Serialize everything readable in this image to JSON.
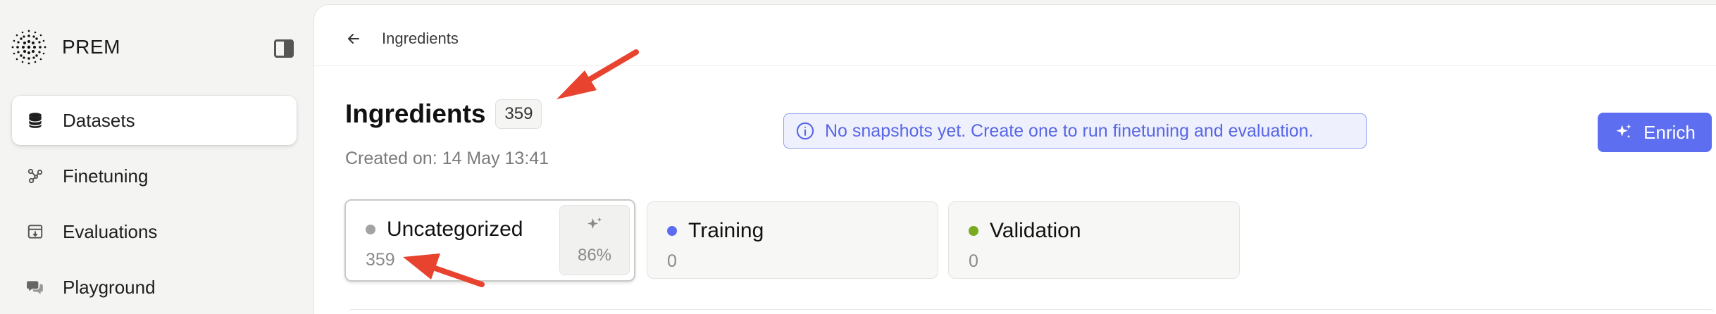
{
  "brand": {
    "name": "PREM"
  },
  "sidebar": {
    "items": [
      {
        "label": "Datasets",
        "icon": "database-icon",
        "active": true
      },
      {
        "label": "Finetuning",
        "icon": "nodes-icon",
        "active": false
      },
      {
        "label": "Evaluations",
        "icon": "archive-download-icon",
        "active": false
      },
      {
        "label": "Playground",
        "icon": "chat-bubbles-icon",
        "active": false
      }
    ]
  },
  "breadcrumb": {
    "label": "Ingredients"
  },
  "header": {
    "title": "Ingredients",
    "count": "359",
    "created": "Created on: 14 May 13:41"
  },
  "banner": {
    "text": "No snapshots yet. Create one to run finetuning and evaluation."
  },
  "enrich_button": {
    "label": "Enrich"
  },
  "splits": [
    {
      "label": "Uncategorized",
      "count": "359",
      "dot_color": "#a3a3a3",
      "enrich_pct": "86%"
    },
    {
      "label": "Training",
      "count": "0",
      "dot_color": "#5b6cf0"
    },
    {
      "label": "Validation",
      "count": "0",
      "dot_color": "#7aaa1e"
    }
  ],
  "colors": {
    "accent": "#5d6ef0",
    "annotation_arrow": "#e8432e"
  }
}
